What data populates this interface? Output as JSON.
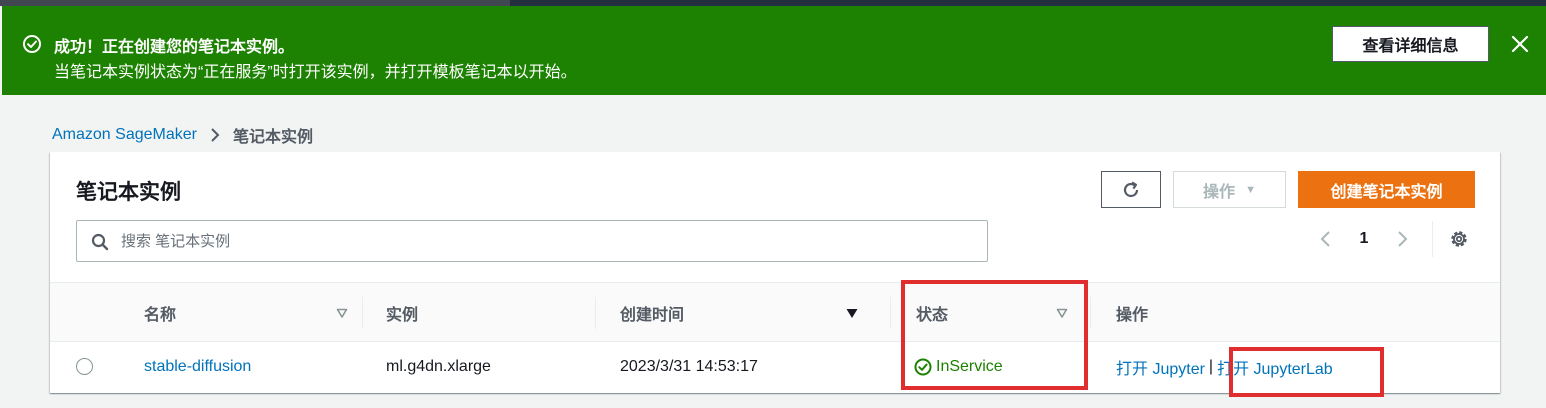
{
  "flash": {
    "title": "成功！正在创建您的笔记本实例。",
    "message": "当笔记本实例状态为“正在服务”时打开该实例，并打开模板笔记本以开始。",
    "details_button": "查看详细信息",
    "color": "#1d8102"
  },
  "breadcrumb": {
    "root": "Amazon SageMaker",
    "current": "笔记本实例"
  },
  "panel": {
    "title": "笔记本实例",
    "actions_label": "操作",
    "create_label": "创建笔记本实例",
    "create_color": "#ec7211"
  },
  "search": {
    "placeholder": "搜索 笔记本实例"
  },
  "pagination": {
    "current_page": "1"
  },
  "table": {
    "columns": {
      "name": "名称",
      "instance": "实例",
      "created": "创建时间",
      "status": "状态",
      "actions": "操作"
    },
    "rows": [
      {
        "name": "stable-diffusion",
        "instance": "ml.g4dn.xlarge",
        "created": "2023/3/31 14:53:17",
        "status": "InService",
        "open_jupyter": "打开 Jupyter",
        "separator": "|",
        "open_jupyterlab": "打开 JupyterLab"
      }
    ]
  },
  "icons": {
    "success": "check-circle-icon",
    "close": "close-icon",
    "breadcrumb_separator": "chevron-right-icon",
    "refresh": "refresh-icon",
    "caret": "caret-down-icon",
    "search": "search-icon",
    "prev": "chevron-left-icon",
    "next": "chevron-right-icon",
    "settings": "gear-icon",
    "sort": "sort-icon"
  },
  "highlight_color": "#e02d2d"
}
